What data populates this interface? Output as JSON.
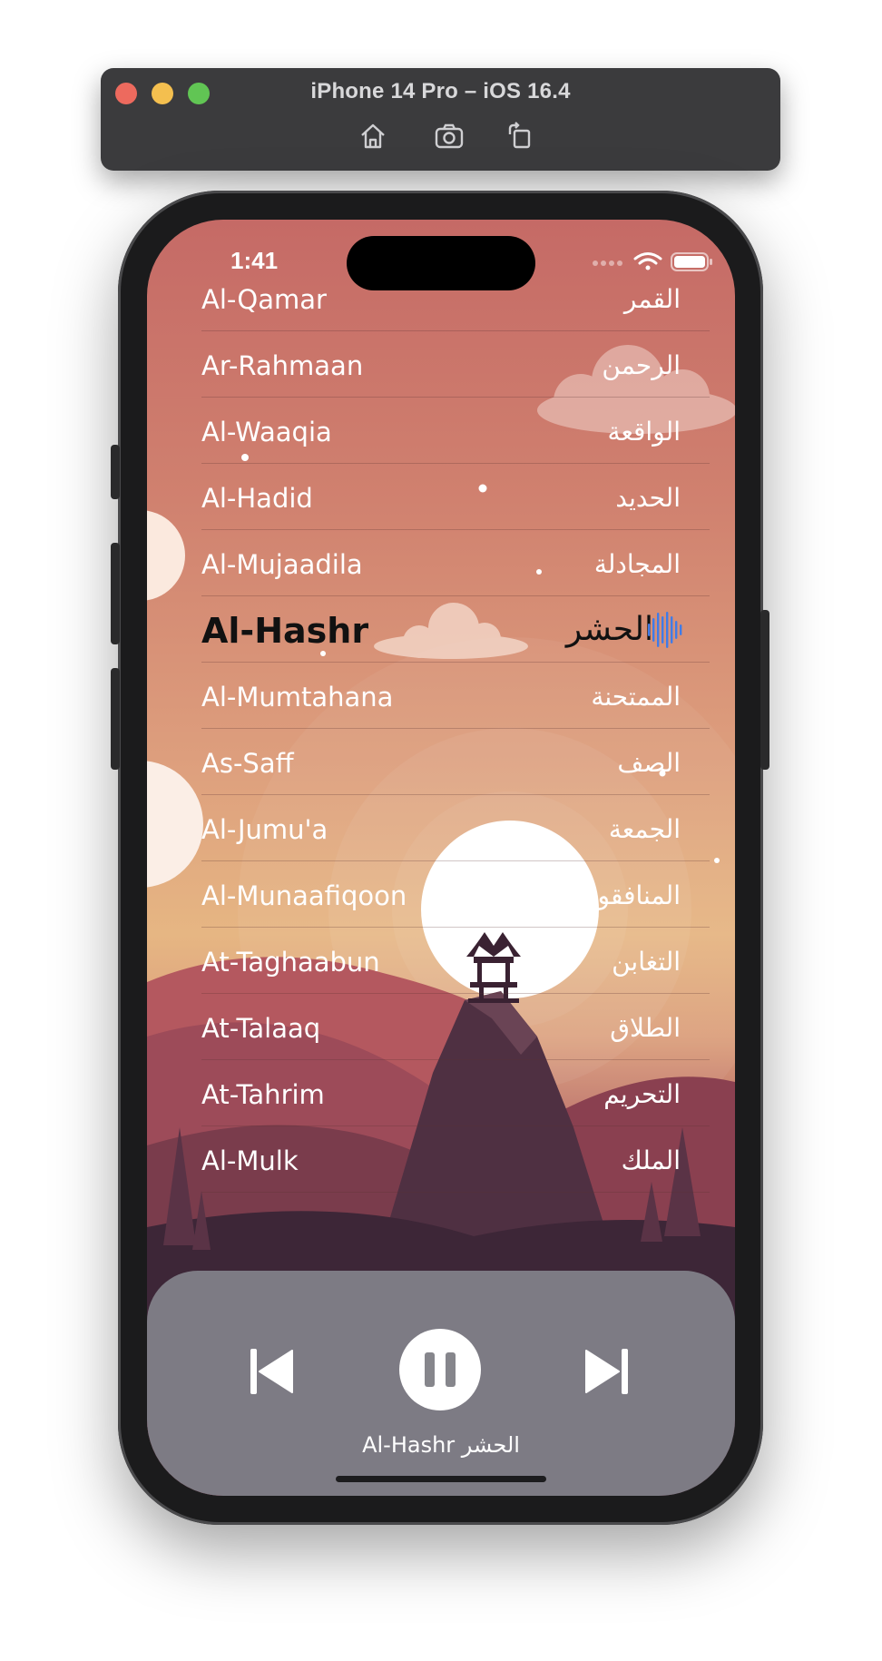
{
  "simulator": {
    "title": "iPhone 14 Pro – iOS 16.4",
    "toolbar_icons": [
      "home-icon",
      "screenshot-icon",
      "rotate-icon"
    ]
  },
  "status_bar": {
    "time": "1:41",
    "icons": [
      "signal-icon",
      "wifi-icon",
      "battery-icon"
    ]
  },
  "surahs": [
    {
      "en": "Al-Qamar",
      "ar": "القمر"
    },
    {
      "en": "Ar-Rahmaan",
      "ar": "الرحمن"
    },
    {
      "en": "Al-Waaqia",
      "ar": "الواقعة"
    },
    {
      "en": "Al-Hadid",
      "ar": "الحديد"
    },
    {
      "en": "Al-Mujaadila",
      "ar": "المجادلة"
    },
    {
      "en": "Al-Hashr",
      "ar": "الحشر"
    },
    {
      "en": "Al-Mumtahana",
      "ar": "الممتحنة"
    },
    {
      "en": "As-Saff",
      "ar": "الصف"
    },
    {
      "en": "Al-Jumu'a",
      "ar": "الجمعة"
    },
    {
      "en": "Al-Munaafiqoon",
      "ar": "المنافقون"
    },
    {
      "en": "At-Taghaabun",
      "ar": "التغابن"
    },
    {
      "en": "At-Talaaq",
      "ar": "الطلاق"
    },
    {
      "en": "At-Tahrim",
      "ar": "التحريم"
    },
    {
      "en": "Al-Mulk",
      "ar": "الملك"
    }
  ],
  "active_index": 5,
  "player": {
    "now_playing": "Al-Hashr الحشر",
    "state": "playing",
    "controls": [
      "previous-icon",
      "pause-icon",
      "next-icon"
    ]
  },
  "colors": {
    "accent_wave": "#3f7be8",
    "player_bg": "#82828a",
    "sun": "#ffffff",
    "mountain": "#4f3042"
  }
}
